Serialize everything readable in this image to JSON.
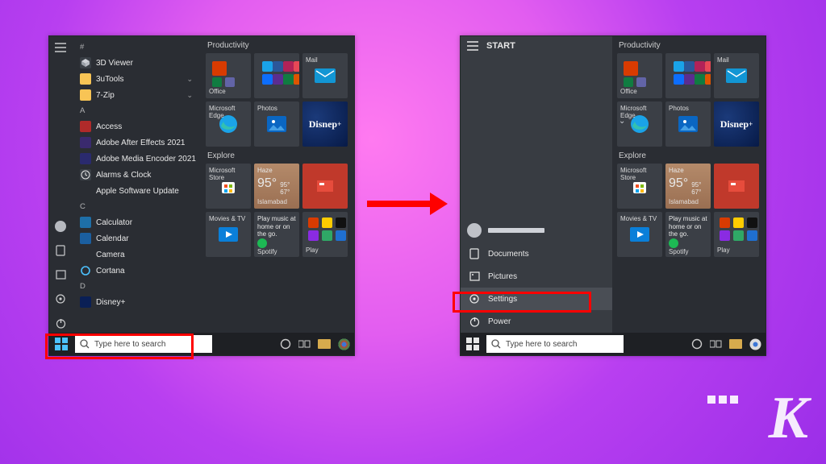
{
  "colors": {
    "office": "#d83b01",
    "edge": "#1aa3e8",
    "photos": "#0a66c2",
    "mail": "#1296d4",
    "store": "#ffffff",
    "tv": "#0a7fd9",
    "spotify": "#1db954",
    "disney": "#0a1f55",
    "folder": "#f8c455",
    "chrome1": "#ea4335",
    "chrome2": "#34a853",
    "chrome3": "#4285f4",
    "chrome4": "#fbbc05"
  },
  "sections": {
    "productivity": "Productivity",
    "explore": "Explore"
  },
  "left": {
    "groups": [
      {
        "header": "#",
        "items": [
          {
            "label": "3D Viewer",
            "icon": "cube",
            "bg": "#3a3f46"
          },
          {
            "label": "3uTools",
            "icon": "folder",
            "bg": "#f8c455",
            "expand": true
          },
          {
            "label": "7-Zip",
            "icon": "folder",
            "bg": "#f8c455",
            "expand": true
          }
        ]
      },
      {
        "header": "A",
        "items": [
          {
            "label": "Access",
            "icon": "square",
            "bg": "#b02a2a"
          },
          {
            "label": "Adobe After Effects 2021",
            "icon": "square",
            "bg": "#3a2a6e"
          },
          {
            "label": "Adobe Media Encoder 2021",
            "icon": "square",
            "bg": "#2a2a6e"
          },
          {
            "label": "Alarms & Clock",
            "icon": "clock",
            "bg": "#3a3f46"
          },
          {
            "label": "Apple Software Update",
            "icon": "blank",
            "bg": "#2a2d33"
          }
        ]
      },
      {
        "header": "C",
        "items": [
          {
            "label": "Calculator",
            "icon": "square",
            "bg": "#1e6fa8"
          },
          {
            "label": "Calendar",
            "icon": "square",
            "bg": "#1b5fa0"
          },
          {
            "label": "Camera",
            "icon": "blank",
            "bg": "#2a2d33"
          },
          {
            "label": "Cortana",
            "icon": "ring",
            "bg": "#2a2d33"
          }
        ]
      },
      {
        "header": "D",
        "items": [
          {
            "label": "Disney+",
            "icon": "square",
            "bg": "#0a1f55"
          }
        ]
      }
    ]
  },
  "tiles_productivity": [
    {
      "label": "Office",
      "kind": "cluster-office"
    },
    {
      "label": "",
      "kind": "cluster-apps"
    },
    {
      "label": "Mail",
      "kind": "mail"
    },
    {
      "label": "Microsoft Edge",
      "kind": "edge"
    },
    {
      "label": "Photos",
      "kind": "photos"
    },
    {
      "label": "",
      "kind": "disney"
    }
  ],
  "tiles_explore": [
    {
      "label": "Microsoft Store",
      "kind": "store"
    },
    {
      "label": "Islamabad",
      "kind": "weather",
      "cond": "Haze",
      "temp": "95°",
      "hi": "95°",
      "lo": "67°"
    },
    {
      "label": "",
      "kind": "red-app"
    },
    {
      "label": "Movies & TV",
      "kind": "tv"
    },
    {
      "label": "Spotify",
      "kind": "spotify",
      "text": "Play music at home or on the go."
    },
    {
      "label": "Play",
      "kind": "mini-cluster"
    }
  ],
  "right": {
    "title": "START",
    "menu": [
      {
        "label": "Documents",
        "icon": "doc"
      },
      {
        "label": "Pictures",
        "icon": "pic"
      },
      {
        "label": "Settings",
        "icon": "gear",
        "highlight": true
      },
      {
        "label": "Power",
        "icon": "power"
      }
    ]
  },
  "search": {
    "placeholder": "Type here to search"
  }
}
